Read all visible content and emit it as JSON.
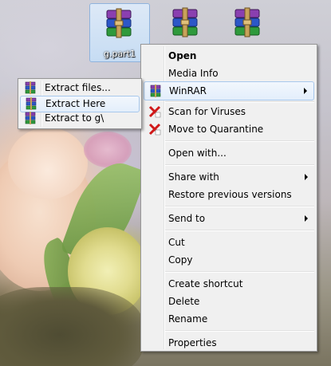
{
  "desktop": {
    "icons": [
      {
        "label": "g.part1",
        "selected": true,
        "icon": "winrar-archive-icon"
      },
      {
        "label": "",
        "selected": false,
        "icon": "winrar-archive-icon"
      },
      {
        "label": "",
        "selected": false,
        "icon": "winrar-archive-icon"
      }
    ]
  },
  "context_menu": {
    "items": [
      {
        "label": "Open",
        "bold": true
      },
      {
        "label": "Media Info"
      },
      {
        "label": "WinRAR",
        "icon": "winrar-icon",
        "submenu": true,
        "highlighted": true
      },
      {
        "label": "Scan for Viruses",
        "icon": "antivirus-icon"
      },
      {
        "label": "Move to Quarantine",
        "icon": "antivirus-icon"
      },
      {
        "label": "Open with..."
      },
      {
        "label": "Share with",
        "submenu": true
      },
      {
        "label": "Restore previous versions"
      },
      {
        "label": "Send to",
        "submenu": true
      },
      {
        "label": "Cut"
      },
      {
        "label": "Copy"
      },
      {
        "label": "Create shortcut"
      },
      {
        "label": "Delete"
      },
      {
        "label": "Rename"
      },
      {
        "label": "Properties"
      }
    ]
  },
  "winrar_submenu": {
    "items": [
      {
        "label": "Extract files...",
        "icon": "winrar-extract-icon"
      },
      {
        "label": "Extract Here",
        "icon": "winrar-extract-icon",
        "highlighted": true
      },
      {
        "label": "Extract to g\\",
        "icon": "winrar-extract-icon"
      }
    ]
  },
  "colors": {
    "menu_bg": "#f0f0f0",
    "highlight_border": "#a8c8ec",
    "selection_bg": "#c6dcf3"
  }
}
